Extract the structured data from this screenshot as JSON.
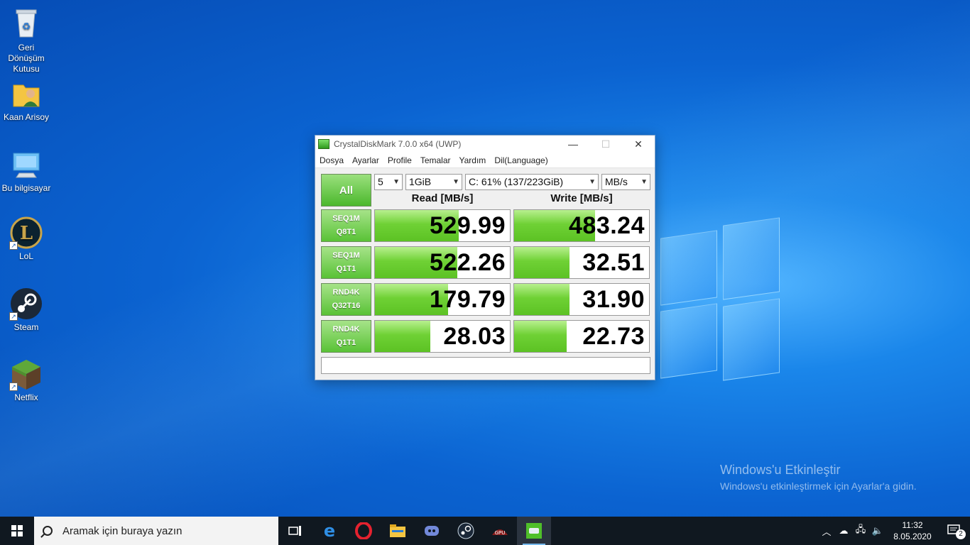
{
  "desktop": {
    "icons": [
      {
        "label": "Geri Dönüşüm Kutusu",
        "icon": "recycle-bin-icon"
      },
      {
        "label": "Kaan Arisoy",
        "icon": "user-folder-icon"
      },
      {
        "label": "Bu bilgisayar",
        "icon": "computer-icon"
      },
      {
        "label": "LoL",
        "icon": "league-of-legends-icon"
      },
      {
        "label": "Steam",
        "icon": "steam-icon"
      },
      {
        "label": "Netflix",
        "icon": "minecraft-icon"
      }
    ],
    "activation": {
      "title": "Windows'u Etkinleştir",
      "subtitle": "Windows'u etkinleştirmek için Ayarlar'a gidin."
    }
  },
  "window": {
    "title": "CrystalDiskMark 7.0.0 x64 (UWP)",
    "controls": {
      "minimize": "—",
      "maximize": "☐",
      "close": "✕"
    },
    "menu": [
      "Dosya",
      "Ayarlar",
      "Profile",
      "Temalar",
      "Yardım",
      "Dil(Language)"
    ],
    "all_button": "All",
    "count": "5",
    "size": "1GiB",
    "drive": "C: 61% (137/223GiB)",
    "unit": "MB/s",
    "read_header": "Read [MB/s]",
    "write_header": "Write [MB/s]",
    "tests": [
      {
        "line1": "SEQ1M",
        "line2": "Q8T1",
        "read": "529.99",
        "write": "483.24",
        "read_fill": 0.62,
        "write_fill": 0.6
      },
      {
        "line1": "SEQ1M",
        "line2": "Q1T1",
        "read": "522.26",
        "write": "32.51",
        "read_fill": 0.61,
        "write_fill": 0.41
      },
      {
        "line1": "RND4K",
        "line2": "Q32T16",
        "read": "179.79",
        "write": "31.90",
        "read_fill": 0.54,
        "write_fill": 0.41
      },
      {
        "line1": "RND4K",
        "line2": "Q1T1",
        "read": "28.03",
        "write": "22.73",
        "read_fill": 0.41,
        "write_fill": 0.39
      }
    ],
    "comment": ""
  },
  "taskbar": {
    "search_placeholder": "Aramak için buraya yazın",
    "apps": [
      "task-view-icon",
      "edge-icon",
      "opera-icon",
      "file-explorer-icon",
      "discord-icon",
      "steam-icon",
      "gpu-tweak-icon",
      "crystaldiskmark-icon"
    ],
    "time": "11:32",
    "date": "8.05.2020",
    "notifications": "2"
  }
}
